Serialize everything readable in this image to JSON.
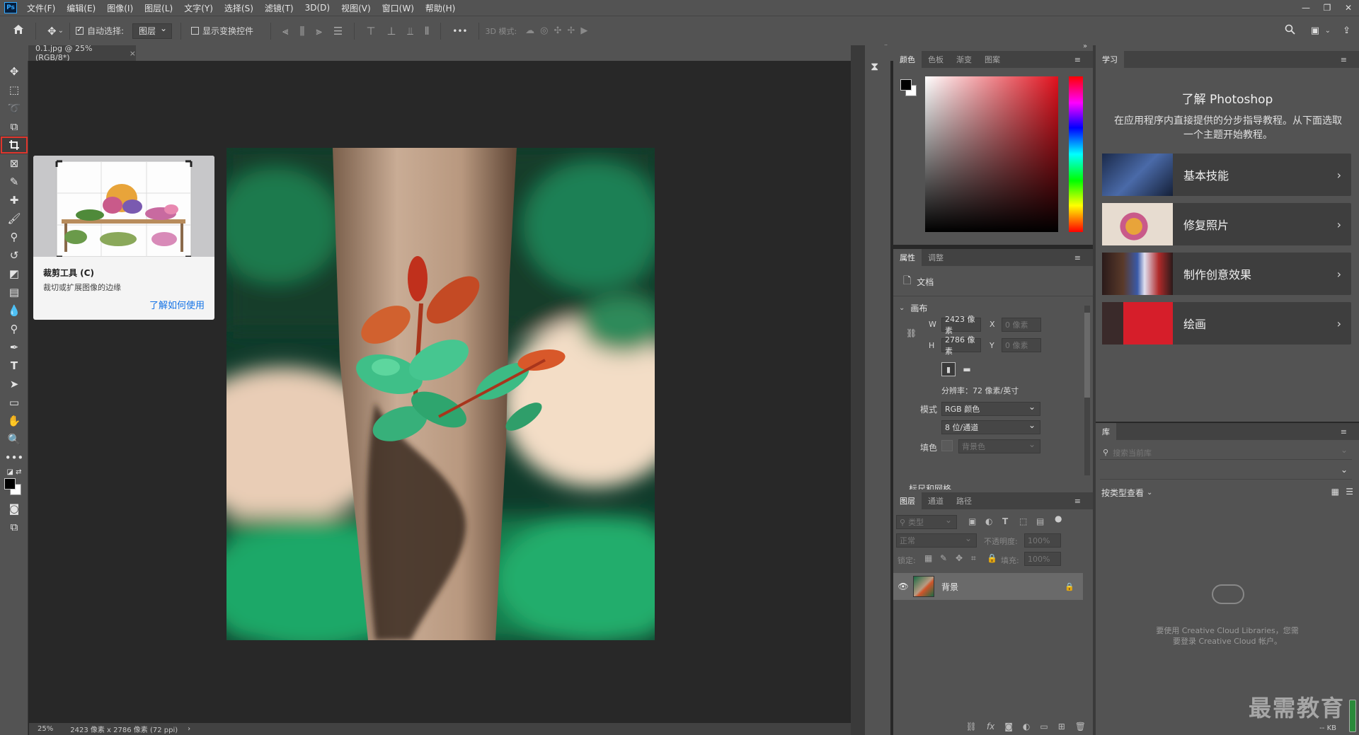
{
  "app": {
    "logo": "Ps"
  },
  "menu": [
    "文件(F)",
    "编辑(E)",
    "图像(I)",
    "图层(L)",
    "文字(Y)",
    "选择(S)",
    "滤镜(T)",
    "3D(D)",
    "视图(V)",
    "窗口(W)",
    "帮助(H)"
  ],
  "window_controls": {
    "minimize": "—",
    "restore": "❐",
    "close": "✕"
  },
  "options": {
    "auto_select_label": "自动选择:",
    "auto_select_value": "图层",
    "show_transform_label": "显示变换控件",
    "more": "•••",
    "mode_3d_label": "3D 模式:"
  },
  "document": {
    "tab_title": "0.1.jpg @ 25%(RGB/8*)",
    "tab_close": "×",
    "zoom": "25%",
    "status_info": "2423 像素 x 2786 像素 (72 ppi)",
    "status_arrow": "›"
  },
  "tooltip": {
    "title": "裁剪工具 (C)",
    "desc": "裁切或扩展图像的边缘",
    "link": "了解如何使用"
  },
  "color_panel": {
    "tabs": [
      "颜色",
      "色板",
      "渐变",
      "图案"
    ],
    "active": 0
  },
  "properties_panel": {
    "tabs": [
      "属性",
      "调整"
    ],
    "doc_label": "文档",
    "canvas_section": "画布",
    "w_label": "W",
    "w_value": "2423 像素",
    "h_label": "H",
    "h_value": "2786 像素",
    "x_label": "X",
    "x_value": "0 像素",
    "y_label": "Y",
    "y_value": "0 像素",
    "resolution": "分辨率：72 像素/英寸",
    "mode_label": "模式",
    "mode_value": "RGB 颜色",
    "depth_value": "8 位/通道",
    "fill_label": "填色",
    "fill_value": "背景色",
    "next_section": "标尺和网格"
  },
  "layers_panel": {
    "tabs": [
      "图层",
      "通道",
      "路径"
    ],
    "filter_placeholder": "类型",
    "blend_mode": "正常",
    "opacity_label": "不透明度:",
    "opacity_value": "100%",
    "lock_label": "锁定:",
    "fill_label": "填充:",
    "fill_value": "100%",
    "layer_name": "背景",
    "bottom_icons": [
      "link-icon",
      "fx-icon",
      "mask-icon",
      "adjustment-icon",
      "group-icon",
      "new-layer-icon",
      "trash-icon"
    ]
  },
  "learn_panel": {
    "tab": "学习",
    "title": "了解 Photoshop",
    "desc": "在应用程序内直接提供的分步指导教程。从下面选取一个主题开始教程。",
    "cards": [
      "基本技能",
      "修复照片",
      "制作创意效果",
      "绘画"
    ],
    "card_arrow": "›"
  },
  "library_panel": {
    "tab": "库",
    "search_placeholder": "搜索当前库",
    "view_label": "按类型查看",
    "message": "要使用 Creative Cloud Libraries，您需要登录 Creative Cloud 帐户。",
    "kb": "-- KB"
  },
  "watermark": "最需教育",
  "colors": {
    "ui": "#535353",
    "dark": "#424242",
    "canvas": "#282828",
    "accent": "#1473e6",
    "highlight": "#e0362d"
  }
}
